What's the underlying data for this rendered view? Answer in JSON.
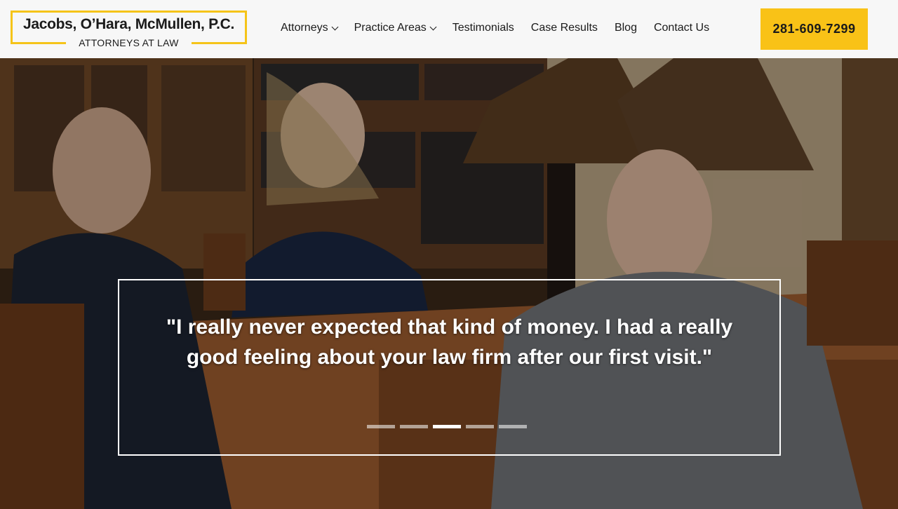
{
  "brand": {
    "name": "Jacobs, O’Hara, McMullen, P.C.",
    "tagline": "ATTORNEYS AT LAW",
    "accent_color": "#f9c217"
  },
  "nav": {
    "items": [
      {
        "label": "Attorneys",
        "has_dropdown": true
      },
      {
        "label": "Practice Areas",
        "has_dropdown": true
      },
      {
        "label": "Testimonials",
        "has_dropdown": false
      },
      {
        "label": "Case Results",
        "has_dropdown": false
      },
      {
        "label": "Blog",
        "has_dropdown": false
      },
      {
        "label": "Contact Us",
        "has_dropdown": false
      }
    ]
  },
  "phone": {
    "label": "281-609-7299"
  },
  "hero": {
    "image_icon": "office-meeting-photo",
    "quote": "\"I really never expected that kind of money. I had a really good feeling about your law firm after our first visit.\"",
    "slides": {
      "count": 5,
      "active_index": 2
    }
  }
}
